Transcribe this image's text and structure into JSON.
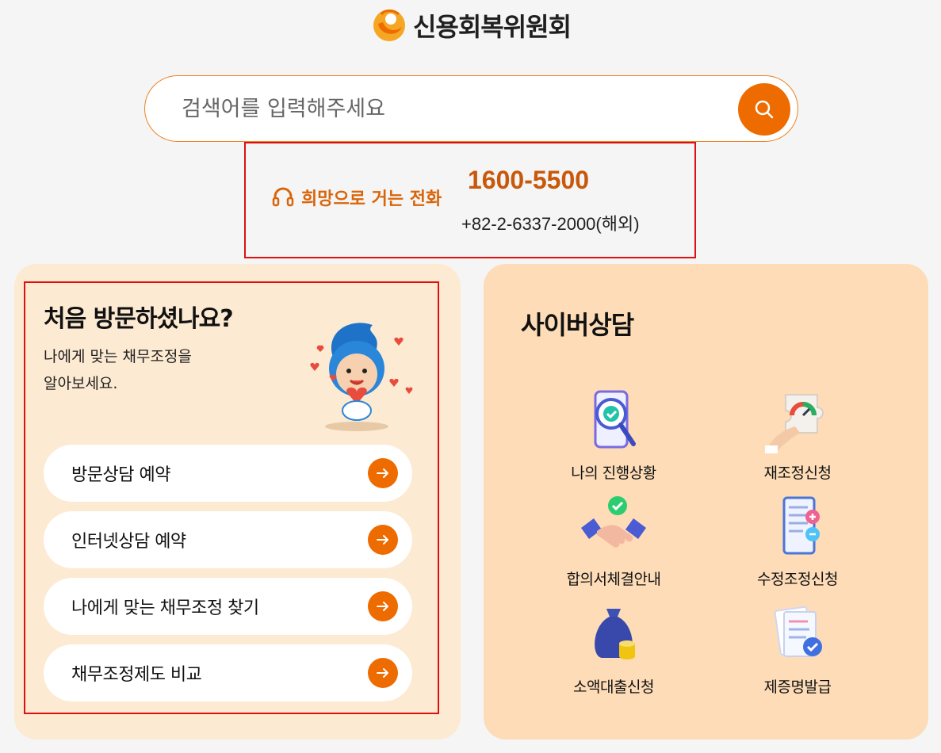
{
  "header": {
    "logo_text": "신용회복위원회"
  },
  "search": {
    "placeholder": "검색어를 입력해주세요"
  },
  "hotline": {
    "label": "희망으로 거는 전화",
    "main_number": "1600-5500",
    "overseas_number": "+82-2-6337-2000(해외)"
  },
  "first_visit": {
    "title": "처음 방문하셨나요?",
    "desc_line1": "나에게 맞는 채무조정을",
    "desc_line2": "알아보세요.",
    "buttons": [
      {
        "label": "방문상담 예약"
      },
      {
        "label": "인터넷상담 예약"
      },
      {
        "label": "나에게 맞는 채무조정 찾기"
      },
      {
        "label": "채무조정제도 비교"
      }
    ]
  },
  "cyber": {
    "title": "사이버상담",
    "items": [
      {
        "label": "나의 진행상황",
        "icon": "magnifier-phone-icon"
      },
      {
        "label": "재조정신청",
        "icon": "puzzle-gauge-icon"
      },
      {
        "label": "합의서체결안내",
        "icon": "handshake-icon"
      },
      {
        "label": "수정조정신청",
        "icon": "document-plus-minus-icon"
      },
      {
        "label": "소액대출신청",
        "icon": "money-bag-icon"
      },
      {
        "label": "제증명발급",
        "icon": "certificate-check-icon"
      }
    ]
  },
  "colors": {
    "accent": "#ee6b00",
    "hotline_text": "#c8580a",
    "left_card_bg": "#fdead2",
    "right_card_bg": "#fddcb7",
    "highlight_box": "#e01010"
  }
}
